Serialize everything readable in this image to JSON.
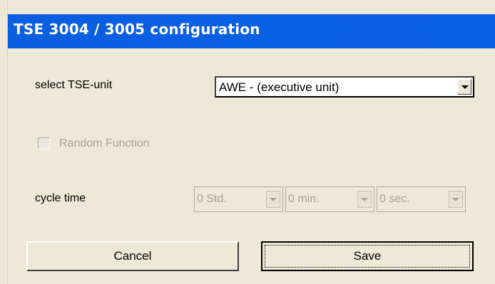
{
  "window": {
    "title": "TSE 3004 / 3005  configuration"
  },
  "unit": {
    "label": "select TSE-unit",
    "selected": "AWE - (executive unit)"
  },
  "random": {
    "label": "Random Function",
    "checked": false,
    "enabled": false
  },
  "cycle": {
    "label": "cycle time",
    "hours": "0 Std.",
    "minutes": "0 min.",
    "seconds": "0 sec."
  },
  "buttons": {
    "cancel": "Cancel",
    "save": "Save"
  }
}
